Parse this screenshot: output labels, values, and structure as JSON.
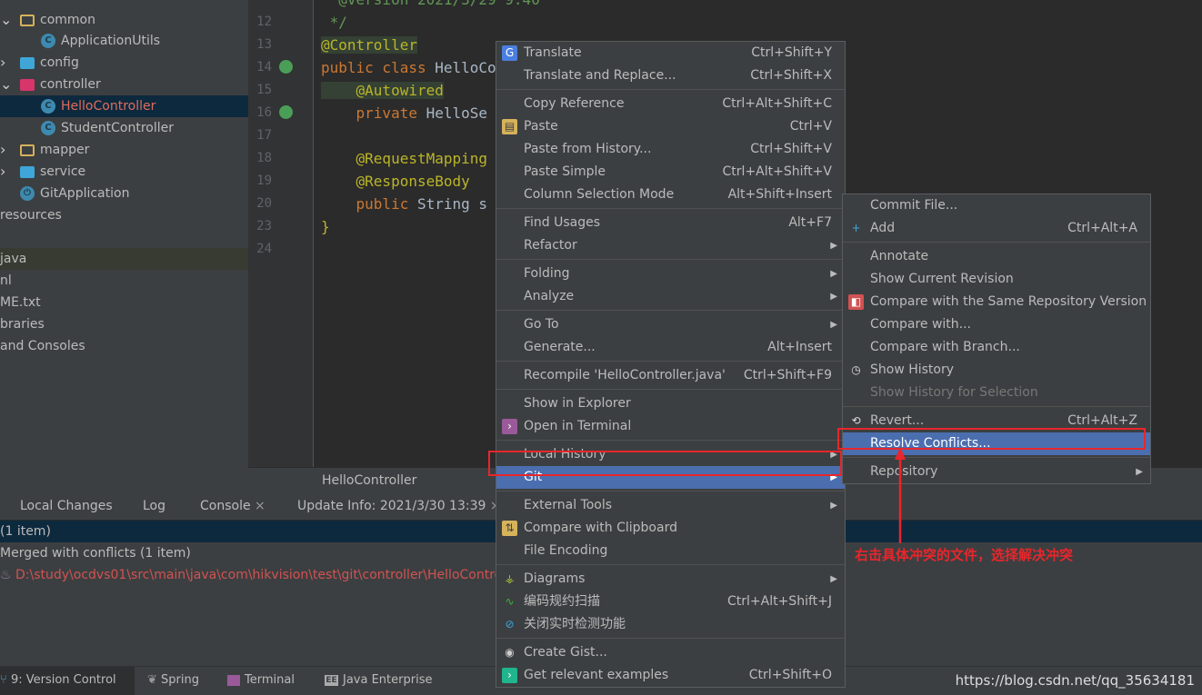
{
  "project_tree": {
    "items": [
      {
        "label": "common",
        "type": "folder",
        "expanded": true
      },
      {
        "label": "ApplicationUtils",
        "type": "class"
      },
      {
        "label": "config",
        "type": "folder",
        "expanded": false
      },
      {
        "label": "controller",
        "type": "folder",
        "expanded": true
      },
      {
        "label": "HelloController",
        "type": "class",
        "selected": true
      },
      {
        "label": "StudentController",
        "type": "class"
      },
      {
        "label": "mapper",
        "type": "folder",
        "expanded": false
      },
      {
        "label": "service",
        "type": "folder",
        "expanded": false
      },
      {
        "label": "GitApplication",
        "type": "spring-app"
      },
      {
        "label": "resources"
      },
      {
        "label": "java"
      },
      {
        "label": "nl"
      },
      {
        "label": "ME.txt"
      },
      {
        "label": "braries"
      },
      {
        "label": "and Consoles"
      }
    ]
  },
  "editor": {
    "lines": [
      {
        "num": "12",
        "text": " */",
        "style": "cm"
      },
      {
        "num": "13",
        "text": "@Controller",
        "style": "an"
      },
      {
        "num": "14",
        "kw": "public class ",
        "text": "HelloCo"
      },
      {
        "num": "15",
        "text": "    @Autowired",
        "style": "an"
      },
      {
        "num": "16",
        "kw": "    private ",
        "text": "HelloSe"
      },
      {
        "num": "17",
        "text": ""
      },
      {
        "num": "18",
        "text": "    @RequestMapping",
        "style": "an"
      },
      {
        "num": "19",
        "text": "    @ResponseBody",
        "style": "an"
      },
      {
        "num": "20",
        "kw": "    public ",
        "text": "String s"
      },
      {
        "num": "23",
        "text": "}",
        "style": "an"
      },
      {
        "num": "24",
        "text": ""
      }
    ],
    "tab": "HelloController"
  },
  "version_control": {
    "tabs": [
      "Local Changes",
      "Log",
      "Console",
      "Update Info: 2021/3/30 13:39"
    ],
    "rows": [
      "(1 item)",
      "Merged with conflicts (1 item)",
      "D:\\study\\ocdvs01\\src\\main\\java\\com\\hikvision\\test\\git\\controller\\HelloControl"
    ]
  },
  "bottom_bar": {
    "tabs": [
      "9: Version Control",
      "Spring",
      "Terminal",
      "Java Enterprise"
    ],
    "watermark": "https://blog.csdn.net/qq_35634181"
  },
  "context_menu": {
    "groups": [
      [
        {
          "label": "Translate",
          "shortcut": "Ctrl+Shift+Y",
          "icon": "translate-icon"
        },
        {
          "label": "Translate and Replace...",
          "shortcut": "Ctrl+Shift+X"
        }
      ],
      [
        {
          "label": "Copy Reference",
          "shortcut": "Ctrl+Alt+Shift+C"
        },
        {
          "label": "Paste",
          "shortcut": "Ctrl+V",
          "icon": "clipboard-icon"
        },
        {
          "label": "Paste from History...",
          "shortcut": "Ctrl+Shift+V"
        },
        {
          "label": "Paste Simple",
          "shortcut": "Ctrl+Alt+Shift+V"
        },
        {
          "label": "Column Selection Mode",
          "shortcut": "Alt+Shift+Insert"
        }
      ],
      [
        {
          "label": "Find Usages",
          "shortcut": "Alt+F7"
        },
        {
          "label": "Refactor",
          "submenu": true
        }
      ],
      [
        {
          "label": "Folding",
          "submenu": true
        },
        {
          "label": "Analyze",
          "submenu": true
        }
      ],
      [
        {
          "label": "Go To",
          "submenu": true
        },
        {
          "label": "Generate...",
          "shortcut": "Alt+Insert"
        }
      ],
      [
        {
          "label": "Recompile 'HelloController.java'",
          "shortcut": "Ctrl+Shift+F9"
        }
      ],
      [
        {
          "label": "Show in Explorer"
        },
        {
          "label": "Open in Terminal",
          "icon": "terminal-icon"
        }
      ],
      [
        {
          "label": "Local History",
          "submenu": true
        },
        {
          "label": "Git",
          "submenu": true,
          "highlighted": true
        }
      ],
      [
        {
          "label": "External Tools",
          "submenu": true
        },
        {
          "label": "Compare with Clipboard",
          "icon": "compare-clipboard-icon"
        },
        {
          "label": "File Encoding"
        }
      ],
      [
        {
          "label": "Diagrams",
          "submenu": true,
          "icon": "diagram-icon"
        },
        {
          "label": "编码规约扫描",
          "shortcut": "Ctrl+Alt+Shift+J",
          "icon": "scan-icon"
        },
        {
          "label": "关闭实时检测功能",
          "icon": "disable-icon"
        }
      ],
      [
        {
          "label": "Create Gist...",
          "icon": "github-icon"
        },
        {
          "label": "Get relevant examples",
          "shortcut": "Ctrl+Shift+O",
          "icon": "examples-icon"
        }
      ]
    ]
  },
  "git_submenu": {
    "groups": [
      [
        {
          "label": "Commit File..."
        },
        {
          "label": "Add",
          "shortcut": "Ctrl+Alt+A",
          "icon": "plus-icon"
        }
      ],
      [
        {
          "label": "Annotate"
        },
        {
          "label": "Show Current Revision"
        },
        {
          "label": "Compare with the Same Repository Version",
          "icon": "compare-icon"
        },
        {
          "label": "Compare with..."
        },
        {
          "label": "Compare with Branch..."
        },
        {
          "label": "Show History",
          "icon": "history-icon"
        },
        {
          "label": "Show History for Selection",
          "disabled": true
        }
      ],
      [
        {
          "label": "Revert...",
          "shortcut": "Ctrl+Alt+Z",
          "icon": "revert-icon"
        },
        {
          "label": "Resolve Conflicts...",
          "highlighted": true
        }
      ],
      [
        {
          "label": "Repository",
          "submenu": true
        }
      ]
    ]
  },
  "annotation": {
    "text": "右击具体冲突的文件，选择解决冲突",
    "color": "#e8262b"
  },
  "colors": {
    "highlight": "#4b6eaf",
    "error_text": "#d25252",
    "panel": "#3c3f41",
    "editor": "#2b2b2b"
  }
}
